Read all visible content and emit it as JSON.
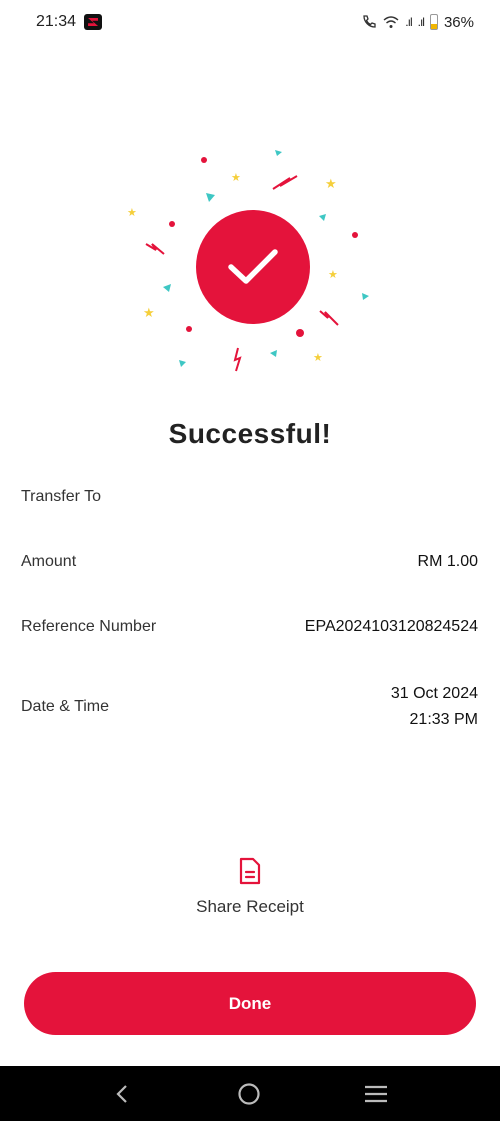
{
  "status_bar": {
    "time": "21:34",
    "battery": "36%"
  },
  "result": {
    "title": "Successful!"
  },
  "details": {
    "transfer_to_label": "Transfer To",
    "transfer_to_value": "",
    "amount_label": "Amount",
    "amount_value": "RM 1.00",
    "reference_label": "Reference Number",
    "reference_value": "EPA2024103120824524",
    "datetime_label": "Date & Time",
    "date_value": "31 Oct 2024",
    "time_value": "21:33 PM"
  },
  "actions": {
    "share_label": "Share Receipt",
    "done_label": "Done"
  },
  "colors": {
    "accent": "#e4133b",
    "confetti_teal": "#3ec7c4",
    "confetti_yellow": "#f5cf3b"
  },
  "icons": {
    "check": "checkmark-icon",
    "share": "document-icon",
    "nav_back": "back-icon",
    "nav_home": "home-icon",
    "nav_menu": "menu-icon"
  }
}
